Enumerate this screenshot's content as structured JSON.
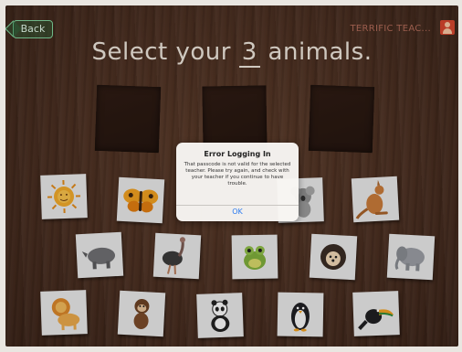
{
  "nav": {
    "back_label": "Back",
    "teacher_name": "TERRIFIC TEAC...",
    "profile_icon": "user-icon"
  },
  "title": {
    "prefix": "Select your",
    "count": "3",
    "suffix": "animals."
  },
  "dialog": {
    "title": "Error Logging In",
    "message": "That passcode is not valid for the selected teacher. Please try again, and check with your teacher if you continue to have trouble.",
    "ok_label": "OK"
  },
  "animals": [
    {
      "row": 1,
      "icon": "sun-icon"
    },
    {
      "row": 1,
      "icon": "butterfly-icon"
    },
    {
      "row": 1,
      "icon": "koala-icon"
    },
    {
      "row": 1,
      "icon": "kangaroo-icon"
    },
    {
      "row": 2,
      "icon": "rhino-icon"
    },
    {
      "row": 2,
      "icon": "ostrich-icon"
    },
    {
      "row": 2,
      "icon": "frog-icon"
    },
    {
      "row": 2,
      "icon": "hedgehog-icon"
    },
    {
      "row": 2,
      "icon": "elephant-icon"
    },
    {
      "row": 3,
      "icon": "lion-icon"
    },
    {
      "row": 3,
      "icon": "monkey-icon"
    },
    {
      "row": 3,
      "icon": "panda-icon"
    },
    {
      "row": 3,
      "icon": "penguin-icon"
    },
    {
      "row": 3,
      "icon": "toucan-icon"
    }
  ],
  "colors": {
    "accent_green": "#7fd19b",
    "link_blue": "#2b7bf0",
    "wood_brown": "#4a2e20"
  }
}
